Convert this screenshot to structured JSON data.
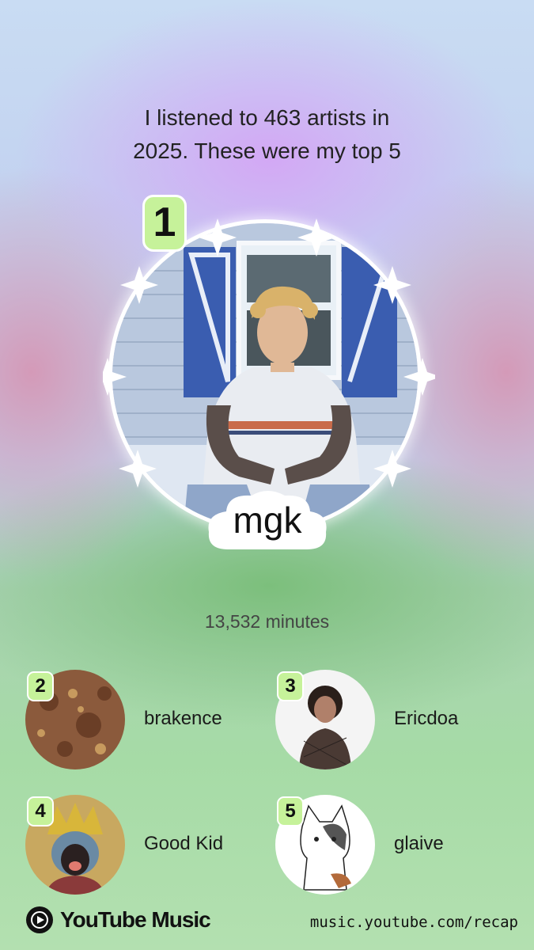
{
  "headline": {
    "line1": "I listened to 463 artists in",
    "line2": "2025. These were my top 5"
  },
  "top_artist": {
    "rank": "1",
    "name": "mgk",
    "minutes": "13,532 minutes"
  },
  "runners_up": [
    {
      "rank": "2",
      "name": "brakence"
    },
    {
      "rank": "3",
      "name": "Ericdoa"
    },
    {
      "rank": "4",
      "name": "Good Kid"
    },
    {
      "rank": "5",
      "name": "glaive"
    }
  ],
  "footer": {
    "brand": "YouTube Music",
    "url": "music.youtube.com/recap"
  },
  "colors": {
    "badge": "#c6f29a",
    "youtube_red": "#ff0000"
  }
}
